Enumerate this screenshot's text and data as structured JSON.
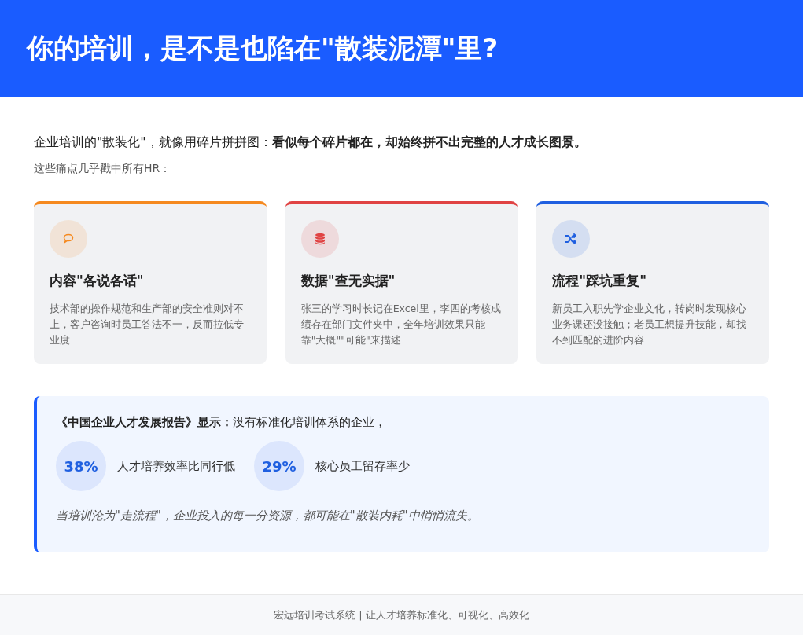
{
  "header": {
    "title": "你的培训，是不是也陷在\"散装泥潭\"里?"
  },
  "intro": "企业培训的\"散装化\"，就像用碎片拼拼图：**看似每个碎片都在，却始终拼不出完整的人才成长图景。**",
  "subtitle": "这些痛点几乎戳中所有HR：",
  "cards": [
    {
      "kind": "chat",
      "color": "#f5891f",
      "title": "内容\"各说各话\"",
      "text": "技术部的操作规范和生产部的安全准则对不上，客户咨询时员工答法不一，反而拉低专业度"
    },
    {
      "kind": "database",
      "color": "#e04343",
      "title": "数据\"查无实据\"",
      "text": "张三的学习时长记在Excel里，李四的考核成绩存在部门文件夹中，全年培训效果只能靠\"大概\"\"可能\"来描述"
    },
    {
      "kind": "shuffle",
      "color": "#1f5fe0",
      "title": "流程\"踩坑重复\"",
      "text": "新员工入职先学企业文化，转岗时发现核心业务课还没接触；老员工想提升技能，却找不到匹配的进阶内容"
    }
  ],
  "report": {
    "lead": "**《中国企业人才发展报告》显示：**没有标准化培训体系的企业，",
    "stats": [
      {
        "value": "38%",
        "label": "人才培养效率比同行低"
      },
      {
        "value": "29%",
        "label": "核心员工留存率少"
      }
    ],
    "conclusion": "当培训沦为\"走流程\"，企业投入的每一分资源，都可能在\"散装内耗\"中悄悄流失。"
  },
  "footer": "宏远培训考试系统 | 让人才培养标准化、可视化、高效化"
}
